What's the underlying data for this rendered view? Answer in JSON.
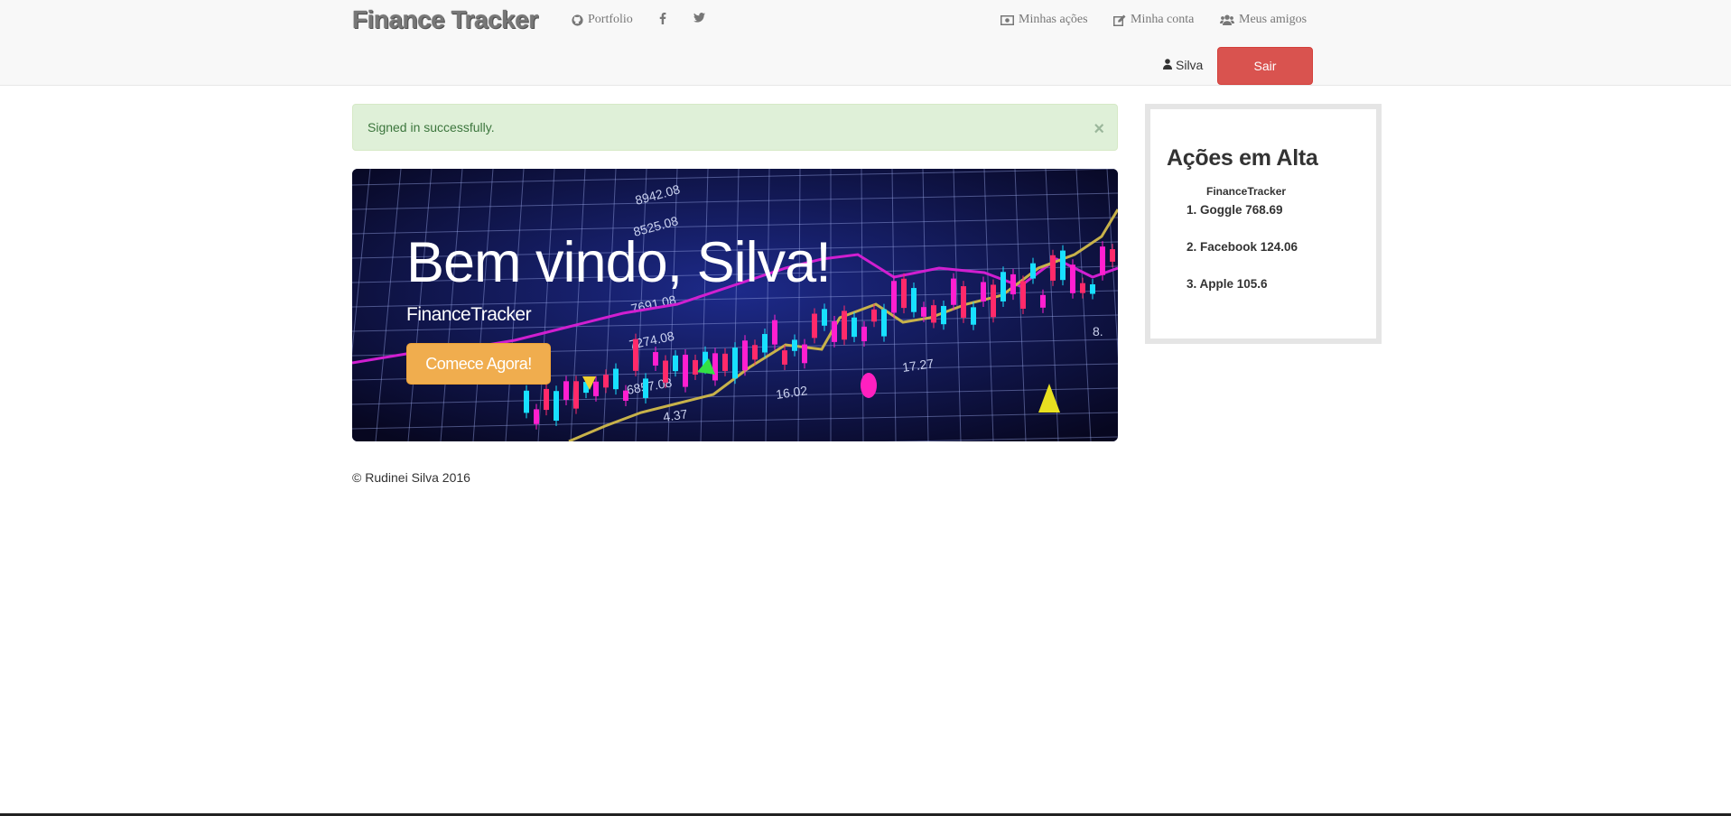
{
  "navbar": {
    "brand": "Finance Tracker",
    "links_left": [
      {
        "label": "Portfolio",
        "icon": "github-icon"
      },
      {
        "label": "",
        "icon": "facebook-icon"
      },
      {
        "label": "",
        "icon": "twitter-icon"
      }
    ],
    "links_right": [
      {
        "label": "Minhas ações",
        "icon": "money-icon"
      },
      {
        "label": "Minha conta",
        "icon": "edit-icon"
      },
      {
        "label": "Meus amigos",
        "icon": "users-icon"
      }
    ],
    "user": {
      "name": "Silva",
      "icon": "user-icon"
    },
    "logout_label": "Sair"
  },
  "alert": {
    "message": "Signed in successfully.",
    "close_label": "×"
  },
  "hero": {
    "heading": "Bem vindo, Silva!",
    "subtitle": "FinanceTracker",
    "cta_label": "Comece Agora!"
  },
  "trending": {
    "title": "Ações em Alta",
    "subtitle": "FinanceTracker",
    "items": [
      "1. Goggle 768.69",
      "2. Facebook 124.06",
      "3. Apple 105.6"
    ]
  },
  "footer": {
    "text": "© Rudinei Silva 2016"
  },
  "colors": {
    "navbar_bg": "#f8f8f8",
    "danger": "#d9534f",
    "warning": "#f0ad4e",
    "success_bg": "#dff0d8",
    "success_text": "#3c763d"
  }
}
